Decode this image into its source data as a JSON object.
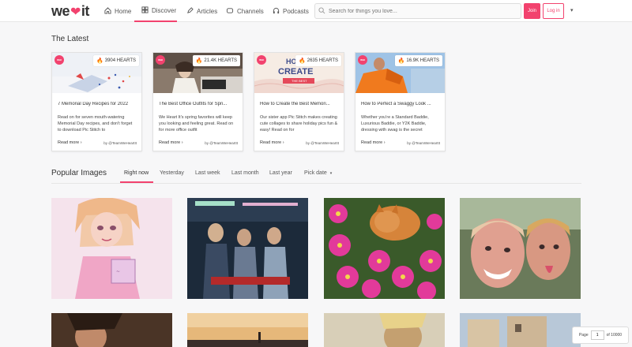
{
  "header": {
    "logo_prefix": "we",
    "logo_suffix": "it",
    "nav": [
      {
        "label": "Home",
        "icon": "home-icon"
      },
      {
        "label": "Discover",
        "icon": "discover-grid-icon"
      },
      {
        "label": "Articles",
        "icon": "pen-icon"
      },
      {
        "label": "Channels",
        "icon": "channels-icon"
      },
      {
        "label": "Podcasts",
        "icon": "headphones-icon"
      }
    ],
    "active_nav": "Discover",
    "search_placeholder": "Search for things you love...",
    "join_label": "Join",
    "login_label": "Log in"
  },
  "latest": {
    "title": "The Latest",
    "cards": [
      {
        "hearts": "3904 HEARTS",
        "title": "7 Memorial Day Recipes for 2022",
        "desc": "Read on for seven mouth-watering Memorial Day recipes, and don't forget to download Pic Stitch to",
        "read_more": "Read more ›",
        "author": "by @TeamWeHeartIt",
        "badge": "WHI"
      },
      {
        "hearts": "21.4K HEARTS",
        "title": "The Best Office Outfits for Spri...",
        "desc": "We Heart It's spring favorites will keep you looking and feeling great. Read on for more office outfit",
        "read_more": "Read more ›",
        "author": "by @TeamWeHeartIt",
        "badge": "WHI"
      },
      {
        "hearts": "2635 HEARTS",
        "title": "How to Create the Best Memori...",
        "desc": "Our sister app Pic Stitch makes creating cute collages to share holiday pics fun & easy! Read on for",
        "read_more": "Read more ›",
        "author": "by @TeamWeHeartIt",
        "badge": "WHI",
        "thumb_text_1": "HO",
        "thumb_text_2": "CREATE",
        "thumb_text_3": "THE BEST"
      },
      {
        "hearts": "16.9K HEARTS",
        "title": "How to Perfect a Swaggy Look ...",
        "desc": "Whether you're a Standard Baddie, Luxurious Baddie, or Y2K Baddie, dressing with swag is the secret",
        "read_more": "Read more ›",
        "author": "by @TeamWeHeartIt",
        "badge": "WHI"
      }
    ]
  },
  "popular": {
    "title": "Popular Images",
    "tabs": [
      "Right now",
      "Yesterday",
      "Last week",
      "Last month",
      "Last year",
      "Pick date"
    ],
    "active_tab": "Right now"
  },
  "pager": {
    "label": "Page",
    "value": "1",
    "suffix": "of 10000"
  },
  "colors": {
    "accent": "#f2426e"
  }
}
